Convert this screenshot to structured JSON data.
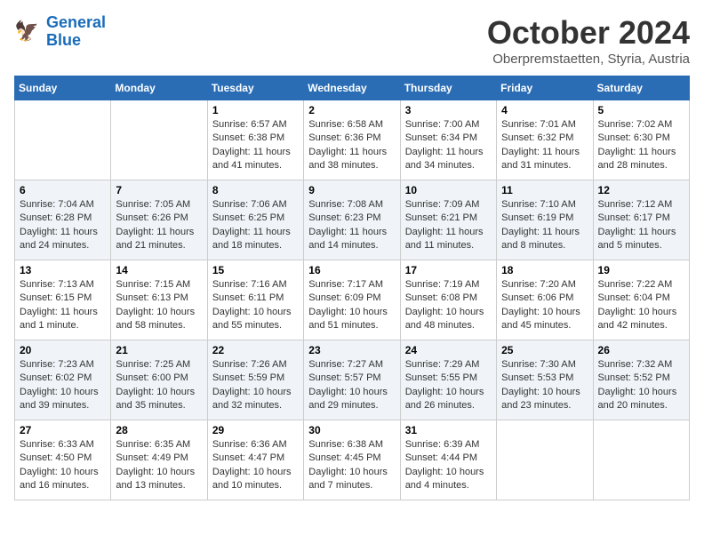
{
  "header": {
    "logo_line1": "General",
    "logo_line2": "Blue",
    "month": "October 2024",
    "location": "Oberpremstaetten, Styria, Austria"
  },
  "days_of_week": [
    "Sunday",
    "Monday",
    "Tuesday",
    "Wednesday",
    "Thursday",
    "Friday",
    "Saturday"
  ],
  "weeks": [
    [
      {
        "day": "",
        "info": ""
      },
      {
        "day": "",
        "info": ""
      },
      {
        "day": "1",
        "info": "Sunrise: 6:57 AM\nSunset: 6:38 PM\nDaylight: 11 hours\nand 41 minutes."
      },
      {
        "day": "2",
        "info": "Sunrise: 6:58 AM\nSunset: 6:36 PM\nDaylight: 11 hours\nand 38 minutes."
      },
      {
        "day": "3",
        "info": "Sunrise: 7:00 AM\nSunset: 6:34 PM\nDaylight: 11 hours\nand 34 minutes."
      },
      {
        "day": "4",
        "info": "Sunrise: 7:01 AM\nSunset: 6:32 PM\nDaylight: 11 hours\nand 31 minutes."
      },
      {
        "day": "5",
        "info": "Sunrise: 7:02 AM\nSunset: 6:30 PM\nDaylight: 11 hours\nand 28 minutes."
      }
    ],
    [
      {
        "day": "6",
        "info": "Sunrise: 7:04 AM\nSunset: 6:28 PM\nDaylight: 11 hours\nand 24 minutes."
      },
      {
        "day": "7",
        "info": "Sunrise: 7:05 AM\nSunset: 6:26 PM\nDaylight: 11 hours\nand 21 minutes."
      },
      {
        "day": "8",
        "info": "Sunrise: 7:06 AM\nSunset: 6:25 PM\nDaylight: 11 hours\nand 18 minutes."
      },
      {
        "day": "9",
        "info": "Sunrise: 7:08 AM\nSunset: 6:23 PM\nDaylight: 11 hours\nand 14 minutes."
      },
      {
        "day": "10",
        "info": "Sunrise: 7:09 AM\nSunset: 6:21 PM\nDaylight: 11 hours\nand 11 minutes."
      },
      {
        "day": "11",
        "info": "Sunrise: 7:10 AM\nSunset: 6:19 PM\nDaylight: 11 hours\nand 8 minutes."
      },
      {
        "day": "12",
        "info": "Sunrise: 7:12 AM\nSunset: 6:17 PM\nDaylight: 11 hours\nand 5 minutes."
      }
    ],
    [
      {
        "day": "13",
        "info": "Sunrise: 7:13 AM\nSunset: 6:15 PM\nDaylight: 11 hours\nand 1 minute."
      },
      {
        "day": "14",
        "info": "Sunrise: 7:15 AM\nSunset: 6:13 PM\nDaylight: 10 hours\nand 58 minutes."
      },
      {
        "day": "15",
        "info": "Sunrise: 7:16 AM\nSunset: 6:11 PM\nDaylight: 10 hours\nand 55 minutes."
      },
      {
        "day": "16",
        "info": "Sunrise: 7:17 AM\nSunset: 6:09 PM\nDaylight: 10 hours\nand 51 minutes."
      },
      {
        "day": "17",
        "info": "Sunrise: 7:19 AM\nSunset: 6:08 PM\nDaylight: 10 hours\nand 48 minutes."
      },
      {
        "day": "18",
        "info": "Sunrise: 7:20 AM\nSunset: 6:06 PM\nDaylight: 10 hours\nand 45 minutes."
      },
      {
        "day": "19",
        "info": "Sunrise: 7:22 AM\nSunset: 6:04 PM\nDaylight: 10 hours\nand 42 minutes."
      }
    ],
    [
      {
        "day": "20",
        "info": "Sunrise: 7:23 AM\nSunset: 6:02 PM\nDaylight: 10 hours\nand 39 minutes."
      },
      {
        "day": "21",
        "info": "Sunrise: 7:25 AM\nSunset: 6:00 PM\nDaylight: 10 hours\nand 35 minutes."
      },
      {
        "day": "22",
        "info": "Sunrise: 7:26 AM\nSunset: 5:59 PM\nDaylight: 10 hours\nand 32 minutes."
      },
      {
        "day": "23",
        "info": "Sunrise: 7:27 AM\nSunset: 5:57 PM\nDaylight: 10 hours\nand 29 minutes."
      },
      {
        "day": "24",
        "info": "Sunrise: 7:29 AM\nSunset: 5:55 PM\nDaylight: 10 hours\nand 26 minutes."
      },
      {
        "day": "25",
        "info": "Sunrise: 7:30 AM\nSunset: 5:53 PM\nDaylight: 10 hours\nand 23 minutes."
      },
      {
        "day": "26",
        "info": "Sunrise: 7:32 AM\nSunset: 5:52 PM\nDaylight: 10 hours\nand 20 minutes."
      }
    ],
    [
      {
        "day": "27",
        "info": "Sunrise: 6:33 AM\nSunset: 4:50 PM\nDaylight: 10 hours\nand 16 minutes."
      },
      {
        "day": "28",
        "info": "Sunrise: 6:35 AM\nSunset: 4:49 PM\nDaylight: 10 hours\nand 13 minutes."
      },
      {
        "day": "29",
        "info": "Sunrise: 6:36 AM\nSunset: 4:47 PM\nDaylight: 10 hours\nand 10 minutes."
      },
      {
        "day": "30",
        "info": "Sunrise: 6:38 AM\nSunset: 4:45 PM\nDaylight: 10 hours\nand 7 minutes."
      },
      {
        "day": "31",
        "info": "Sunrise: 6:39 AM\nSunset: 4:44 PM\nDaylight: 10 hours\nand 4 minutes."
      },
      {
        "day": "",
        "info": ""
      },
      {
        "day": "",
        "info": ""
      }
    ]
  ]
}
